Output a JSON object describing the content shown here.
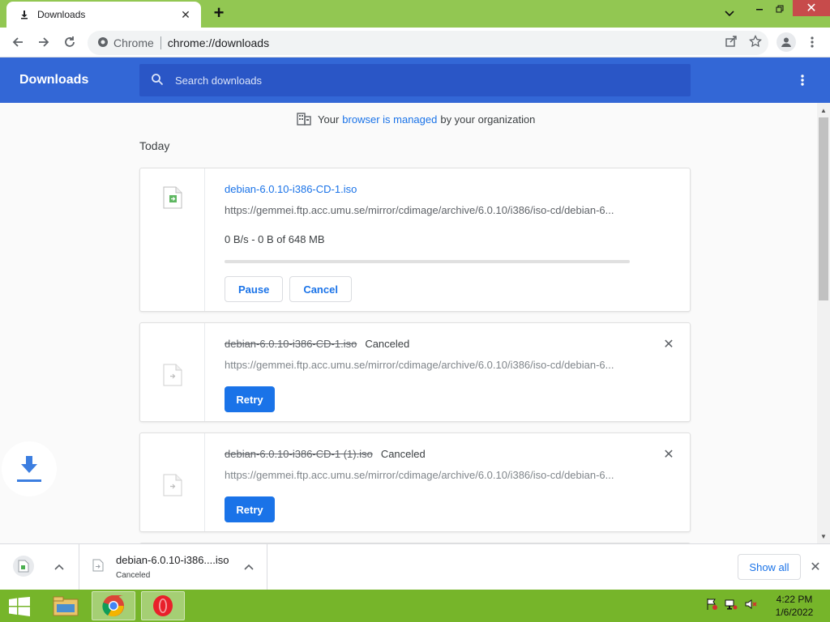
{
  "tab": {
    "title": "Downloads"
  },
  "omnibox": {
    "site": "Chrome",
    "url": "chrome://downloads"
  },
  "header": {
    "title": "Downloads",
    "search_placeholder": "Search downloads"
  },
  "managed": {
    "prefix": "Your",
    "link": "browser is managed",
    "suffix": "by your organization"
  },
  "section_date": "Today",
  "downloads": [
    {
      "filename": "debian-6.0.10-i386-CD-1.iso",
      "url": "https://gemmei.ftp.acc.umu.se/mirror/cdimage/archive/6.0.10/i386/iso-cd/debian-6...",
      "progress_text": "0 B/s - 0 B of 648 MB",
      "progress": 0,
      "pause_label": "Pause",
      "cancel_label": "Cancel"
    },
    {
      "filename": "debian-6.0.10-i386-CD-1.iso",
      "status": "Canceled",
      "url": "https://gemmei.ftp.acc.umu.se/mirror/cdimage/archive/6.0.10/i386/iso-cd/debian-6...",
      "retry_label": "Retry"
    },
    {
      "filename": "debian-6.0.10-i386-CD-1 (1).iso",
      "status": "Canceled",
      "url": "https://gemmei.ftp.acc.umu.se/mirror/cdimage/archive/6.0.10/i386/iso-cd/debian-6...",
      "retry_label": "Retry"
    }
  ],
  "shelf": {
    "item_name": "debian-6.0.10-i386....iso",
    "item_status": "Canceled",
    "show_all": "Show all"
  },
  "taskbar": {
    "time": "4:22 PM",
    "date": "1/6/2022"
  },
  "colors": {
    "accent": "#1a73e8",
    "header": "#3367d6",
    "taskbar": "#76b52a",
    "tabstrip": "#92c752"
  }
}
